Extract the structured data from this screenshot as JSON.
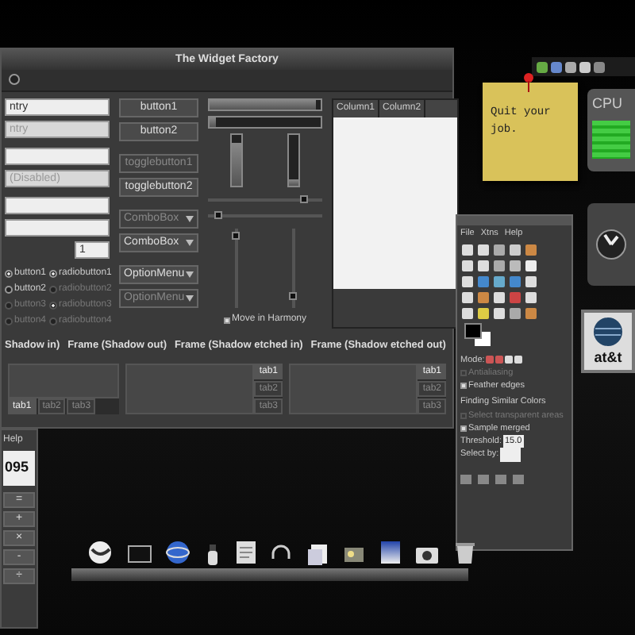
{
  "widget_factory": {
    "title": "The Widget Factory",
    "entries": [
      {
        "value": "ntry",
        "disabled": false
      },
      {
        "value": "ntry",
        "disabled": true
      },
      {
        "disabled": false
      },
      {
        "value": "(Disabled)",
        "disabled": true
      },
      {
        "disabled": false
      },
      {
        "disabled": false
      }
    ],
    "spin_value": "1",
    "radios": [
      {
        "label": "button1",
        "checked": true,
        "disabled": false
      },
      {
        "label": "radiobutton1",
        "checked": true,
        "disabled": false
      },
      {
        "label": "button2",
        "checked": false,
        "disabled": false
      },
      {
        "label": "radiobutton2",
        "checked": false,
        "disabled": true
      },
      {
        "label": "button3",
        "checked": false,
        "disabled": true
      },
      {
        "label": "radiobutton3",
        "checked": true,
        "disabled": true
      },
      {
        "label": "button4",
        "checked": false,
        "disabled": true
      },
      {
        "label": "radiobutton4",
        "checked": false,
        "disabled": true
      }
    ],
    "buttons": [
      {
        "kind": "button",
        "label": "button1",
        "disabled": false
      },
      {
        "kind": "button",
        "label": "button2",
        "disabled": false
      },
      {
        "kind": "button",
        "label": "togglebutton1",
        "disabled": true
      },
      {
        "kind": "button",
        "label": "togglebutton2",
        "disabled": false
      },
      {
        "kind": "combo",
        "label": "ComboBox",
        "disabled": true
      },
      {
        "kind": "combo",
        "label": "ComboBox",
        "disabled": false
      },
      {
        "kind": "combo",
        "label": "OptionMenu",
        "disabled": false
      },
      {
        "kind": "combo",
        "label": "OptionMenu",
        "disabled": true
      }
    ],
    "progress_bars": [
      {
        "kind": "horizontal",
        "level": 0.95
      },
      {
        "kind": "horizontal",
        "level": 0.05
      },
      {
        "kind": "vertical",
        "level": 0.85
      },
      {
        "kind": "vertical",
        "level": 0.12
      }
    ],
    "scales": [
      {
        "kind": "horizontal",
        "level": 0.85
      },
      {
        "kind": "horizontal",
        "level": 0.1
      },
      {
        "kind": "vertical",
        "level": 0.9
      },
      {
        "kind": "vertical",
        "level": 0.15
      }
    ],
    "harmony": {
      "label": "Move in Harmony",
      "checked": true
    },
    "tree_columns": [
      "Column1",
      "Column2"
    ],
    "frames": [
      "Shadow in)",
      "Frame (Shadow out)",
      "Frame (Shadow etched in)",
      "Frame (Shadow etched out)"
    ],
    "notebooks": [
      {
        "kind": "bottom",
        "tabs": [
          {
            "label": "tab1",
            "selected": true
          },
          {
            "label": "tab2",
            "selected": false
          },
          {
            "label": "tab3",
            "selected": false
          }
        ]
      },
      {
        "kind": "right",
        "tabs": [
          {
            "label": "tab1",
            "selected": true
          },
          {
            "label": "tab2",
            "selected": false
          },
          {
            "label": "tab3",
            "selected": false
          }
        ]
      },
      {
        "kind": "right",
        "tabs": [
          {
            "label": "tab1",
            "selected": true
          },
          {
            "label": "tab2",
            "selected": false
          },
          {
            "label": "tab3",
            "selected": false
          }
        ]
      }
    ]
  },
  "sticky_note": {
    "text": "Quit your job."
  },
  "cpu_widget": {
    "title": "CPU"
  },
  "att_widget": {
    "text": "at&t"
  },
  "toolbox": {
    "menu": [
      "File",
      "Xtns",
      "Help"
    ],
    "mode_label": "Mode:",
    "options": [
      {
        "label": "Antialiasing",
        "checked": false,
        "disabled": true
      },
      {
        "label": "Feather edges",
        "checked": true,
        "disabled": false
      }
    ],
    "section": "Finding Similar Colors",
    "options2": [
      {
        "label": "Select transparent areas",
        "checked": false,
        "disabled": true
      },
      {
        "label": "Sample merged",
        "checked": true,
        "disabled": false
      }
    ],
    "threshold_label": "Threshold:",
    "threshold": "15.0",
    "select_by_label": "Select by:"
  },
  "calculator": {
    "menu": [
      "Help"
    ],
    "display": "095",
    "keys": [
      "=",
      "+",
      "×",
      "-",
      "÷"
    ]
  }
}
